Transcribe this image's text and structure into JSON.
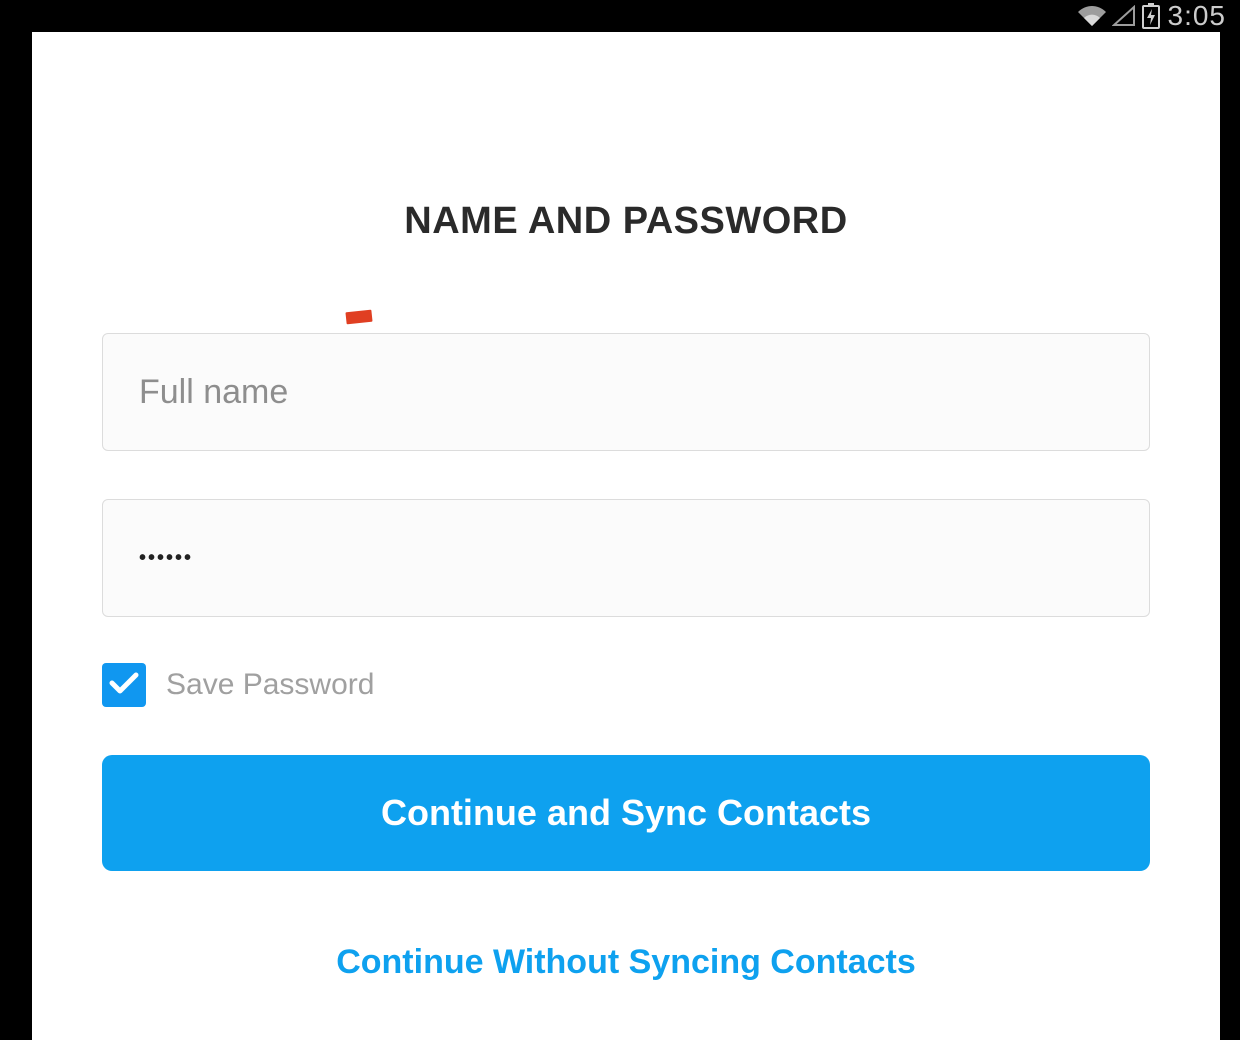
{
  "statusbar": {
    "time": "3:05"
  },
  "form": {
    "title": "NAME AND PASSWORD",
    "name_placeholder": "Full name",
    "name_value": "",
    "password_value": "••••••",
    "save_password_label": "Save Password",
    "save_password_checked": true,
    "primary_button_label": "Continue and Sync Contacts",
    "secondary_button_label": "Continue Without Syncing Contacts"
  },
  "colors": {
    "accent": "#0ea1ef"
  }
}
